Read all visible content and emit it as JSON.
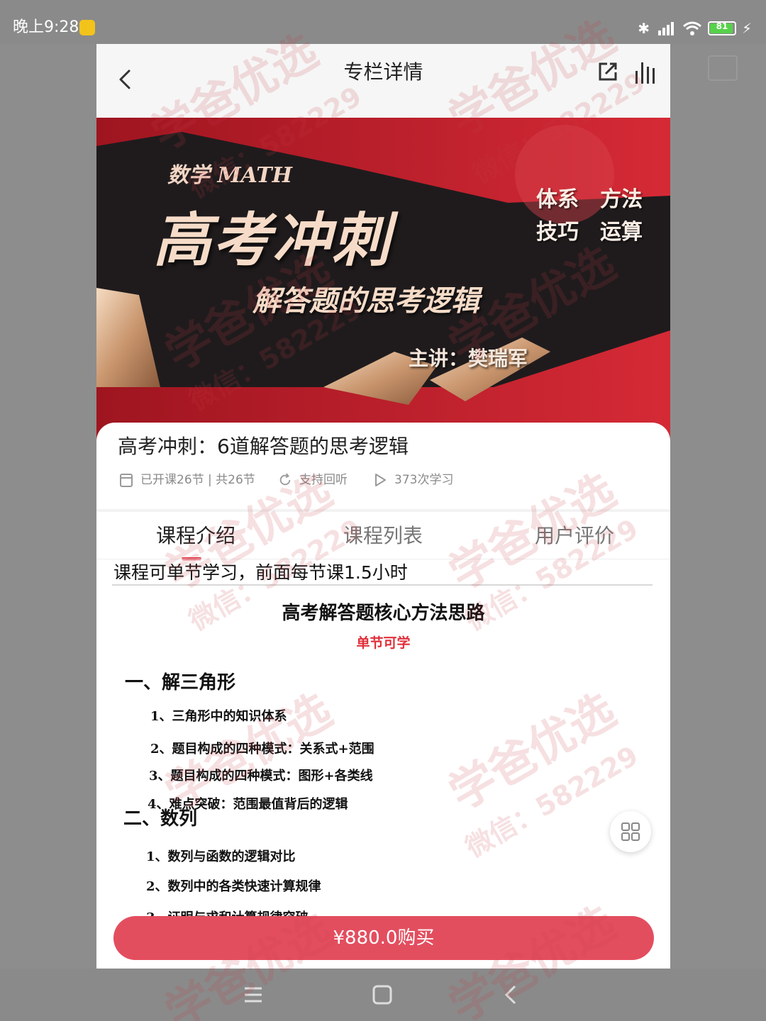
{
  "status_bar": {
    "time": "晚上9:28",
    "battery": "81"
  },
  "header": {
    "title": "专栏详情"
  },
  "banner": {
    "subject": "数学 MATH",
    "title": "高考冲刺",
    "subtitle": "解答题的思考逻辑",
    "teacher": "主讲：樊瑞军",
    "tags": [
      "体系",
      "方法",
      "技巧",
      "运算"
    ]
  },
  "course": {
    "title": "高考冲刺：6道解答题的思考逻辑",
    "lessons": "已开课26节 | 共26节",
    "replay": "支持回听",
    "study_count": "373次学习"
  },
  "tabs": [
    {
      "label": "课程介绍",
      "active": true
    },
    {
      "label": "课程列表",
      "active": false
    },
    {
      "label": "用户评价",
      "active": false
    }
  ],
  "intro": {
    "line": "课程可单节学习，前面每节课1.5小时"
  },
  "outline": {
    "heading": "高考解答题核心方法思路",
    "subheading": "单节可学",
    "sections": [
      {
        "title": "一、解三角形",
        "items": [
          "1、三角形中的知识体系",
          "2、题目构成的四种模式：关系式+范围",
          "3、题目构成的四种模式：图形+各类线",
          "4、难点突破：范围最值背后的逻辑"
        ]
      },
      {
        "title": "二、数列",
        "items": [
          "1、数列与函数的逻辑对比",
          "2、数列中的各类快速计算规律",
          "3、证明与求和计算规律突破"
        ]
      }
    ]
  },
  "buy_button": {
    "label": "¥880.0购买"
  },
  "watermark": {
    "brand": "学爸优选",
    "contact": "微信：582229"
  },
  "colors": {
    "accent": "#e34e5f",
    "tab_indicator": "#e63a4a",
    "banner_red": "#c42530",
    "banner_dark": "#1f1b1d"
  }
}
